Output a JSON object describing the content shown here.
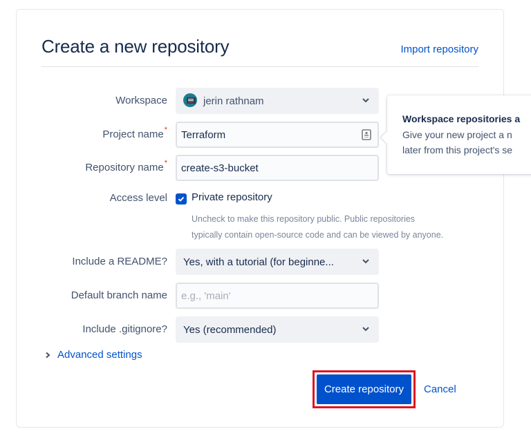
{
  "header": {
    "title": "Create a new repository",
    "import_link": "Import repository"
  },
  "form": {
    "workspace": {
      "label": "Workspace",
      "value": "jerin rathnam",
      "icon": "workspace-avatar-icon"
    },
    "project_name": {
      "label": "Project name",
      "required_mark": "*",
      "value": "Terraform",
      "icon": "contact-card-icon"
    },
    "repository_name": {
      "label": "Repository name",
      "required_mark": "*",
      "value": "create-s3-bucket"
    },
    "access_level": {
      "label": "Access level",
      "checkbox_label": "Private repository",
      "checked": true,
      "help_line1": "Uncheck to make this repository public. Public repositories",
      "help_line2": "typically contain open-source code and can be viewed by anyone."
    },
    "readme": {
      "label": "Include a README?",
      "value": "Yes, with a tutorial (for beginne..."
    },
    "default_branch": {
      "label": "Default branch name",
      "value": "",
      "placeholder": "e.g., 'main'"
    },
    "gitignore": {
      "label": "Include .gitignore?",
      "value": "Yes (recommended)"
    },
    "advanced_settings": "Advanced settings"
  },
  "actions": {
    "create_label": "Create repository",
    "cancel_label": "Cancel"
  },
  "tooltip": {
    "title": "Workspace repositories a",
    "body_line1": "Give your new project a n",
    "body_line2": "later from this project's se"
  },
  "colors": {
    "primary": "#0052cc",
    "highlight_outline": "#e0141e",
    "required": "#de350b"
  }
}
